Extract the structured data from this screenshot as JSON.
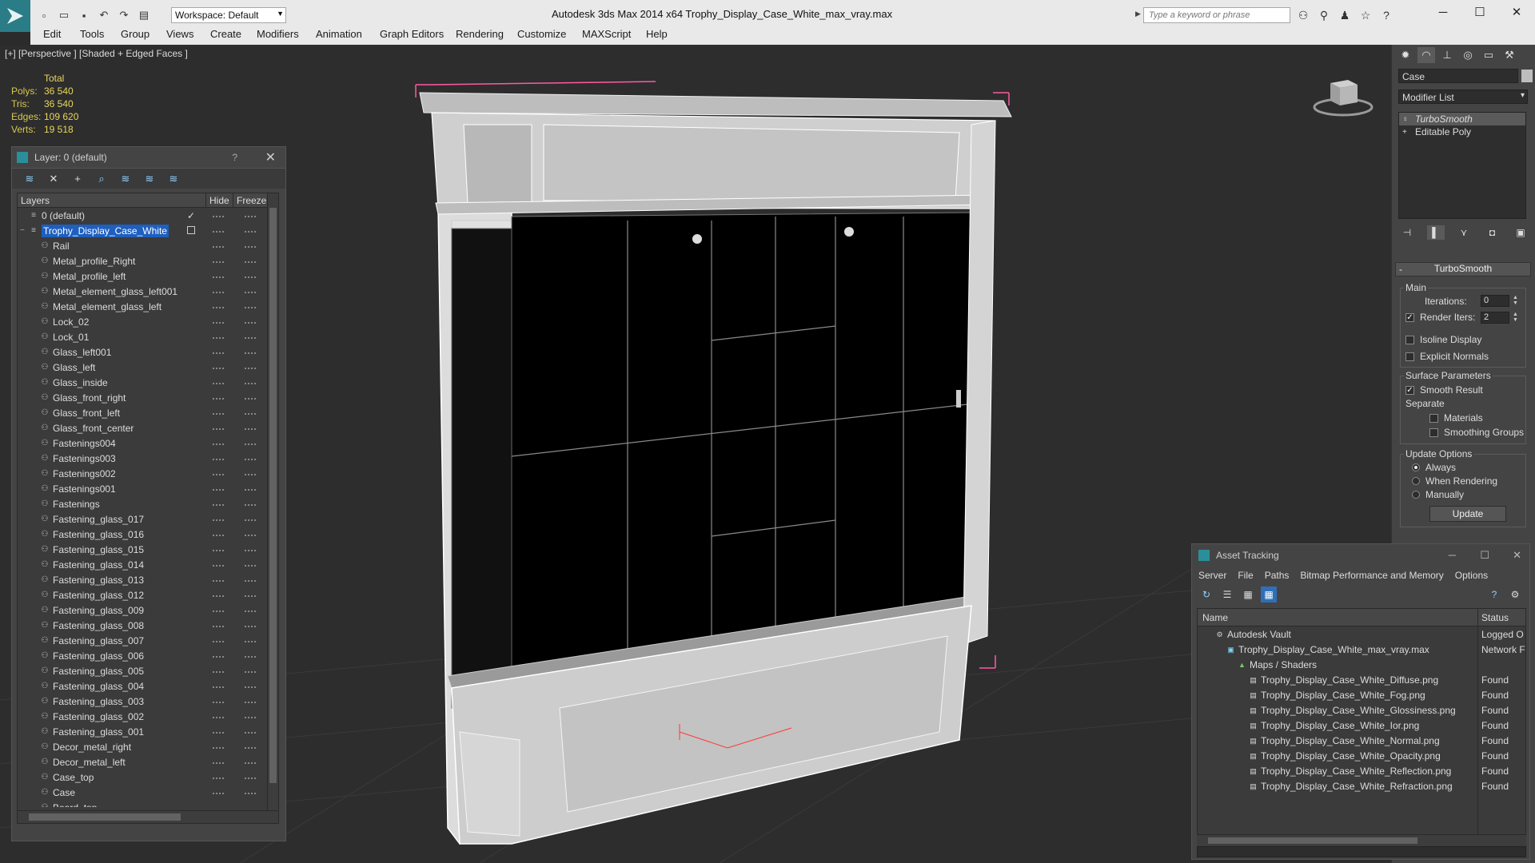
{
  "titlebar": {
    "workspace": "Workspace: Default",
    "title": "Autodesk 3ds Max  2014 x64      Trophy_Display_Case_White_max_vray.max",
    "search_placeholder": "Type a keyword or phrase"
  },
  "menu": [
    "Edit",
    "Tools",
    "Group",
    "Views",
    "Create",
    "Modifiers",
    "Animation",
    "Graph Editors",
    "Rendering",
    "Customize",
    "MAXScript",
    "Help"
  ],
  "viewport": {
    "label": "[+] [Perspective ] [Shaded + Edged Faces ]",
    "stats": {
      "header": "Total",
      "rows": [
        {
          "label": "Polys:",
          "value": "36 540"
        },
        {
          "label": "Tris:",
          "value": "36 540"
        },
        {
          "label": "Edges:",
          "value": "109 620"
        },
        {
          "label": "Verts:",
          "value": "19 518"
        }
      ]
    }
  },
  "layer_window": {
    "title": "Layer: 0 (default)",
    "help": "?",
    "columns": {
      "layers": "Layers",
      "hide": "Hide",
      "freeze": "Freeze"
    },
    "layers": [
      {
        "name": "0 (default)",
        "level": 0,
        "checked": true
      },
      {
        "name": "Trophy_Display_Case_White",
        "level": 0,
        "selected": true
      }
    ],
    "objects": [
      "Rail",
      "Metal_profile_Right",
      "Metal_profile_left",
      "Metal_element_glass_left001",
      "Metal_element_glass_left",
      "Lock_02",
      "Lock_01",
      "Glass_left001",
      "Glass_left",
      "Glass_inside",
      "Glass_front_right",
      "Glass_front_left",
      "Glass_front_center",
      "Fastenings004",
      "Fastenings003",
      "Fastenings002",
      "Fastenings001",
      "Fastenings",
      "Fastening_glass_017",
      "Fastening_glass_016",
      "Fastening_glass_015",
      "Fastening_glass_014",
      "Fastening_glass_013",
      "Fastening_glass_012",
      "Fastening_glass_009",
      "Fastening_glass_008",
      "Fastening_glass_007",
      "Fastening_glass_006",
      "Fastening_glass_005",
      "Fastening_glass_004",
      "Fastening_glass_003",
      "Fastening_glass_002",
      "Fastening_glass_001",
      "Decor_metal_right",
      "Decor_metal_left",
      "Case_top",
      "Case",
      "Board_top"
    ]
  },
  "command_panel": {
    "object_name": "Case",
    "modifier_list": "Modifier List",
    "stack": [
      "TurboSmooth",
      "Editable Poly"
    ],
    "turbosmooth": {
      "title": "TurboSmooth",
      "main_label": "Main",
      "iterations_label": "Iterations:",
      "iterations": "0",
      "render_iters_label": "Render Iters:",
      "render_iters": "2",
      "isoline": "Isoline Display",
      "explicit_normals": "Explicit Normals",
      "surface_params": "Surface Parameters",
      "smooth_result": "Smooth Result",
      "separate": "Separate",
      "materials": "Materials",
      "smoothing_groups": "Smoothing Groups",
      "update_options": "Update Options",
      "always": "Always",
      "when_rendering": "When Rendering",
      "manually": "Manually",
      "update_btn": "Update"
    }
  },
  "asset_tracking": {
    "title": "Asset Tracking",
    "menu": [
      "Server",
      "File",
      "Paths",
      "Bitmap Performance and Memory",
      "Options"
    ],
    "columns": {
      "name": "Name",
      "status": "Status"
    },
    "rows": [
      {
        "name": "Autodesk Vault",
        "status": "Logged O",
        "indent": 0
      },
      {
        "name": "Trophy_Display_Case_White_max_vray.max",
        "status": "Network F",
        "indent": 1
      },
      {
        "name": "Maps / Shaders",
        "status": "",
        "indent": 2
      },
      {
        "name": "Trophy_Display_Case_White_Diffuse.png",
        "status": "Found",
        "indent": 3
      },
      {
        "name": "Trophy_Display_Case_White_Fog.png",
        "status": "Found",
        "indent": 3
      },
      {
        "name": "Trophy_Display_Case_White_Glossiness.png",
        "status": "Found",
        "indent": 3
      },
      {
        "name": "Trophy_Display_Case_White_Ior.png",
        "status": "Found",
        "indent": 3
      },
      {
        "name": "Trophy_Display_Case_White_Normal.png",
        "status": "Found",
        "indent": 3
      },
      {
        "name": "Trophy_Display_Case_White_Opacity.png",
        "status": "Found",
        "indent": 3
      },
      {
        "name": "Trophy_Display_Case_White_Reflection.png",
        "status": "Found",
        "indent": 3
      },
      {
        "name": "Trophy_Display_Case_White_Refraction.png",
        "status": "Found",
        "indent": 3
      }
    ]
  }
}
